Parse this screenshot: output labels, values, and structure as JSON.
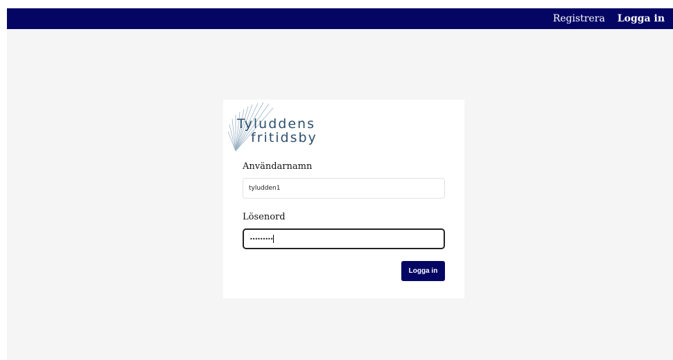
{
  "header": {
    "register_label": "Registrera",
    "login_label": "Logga in"
  },
  "logo": {
    "line1": "Tyluddens",
    "line2": "fritidsby"
  },
  "form": {
    "username_label": "Användarnamn",
    "username_value": "tyludden1",
    "password_label": "Lösenord",
    "password_masked": "•••••••••",
    "submit_label": "Logga in"
  },
  "colors": {
    "brand_navy": "#050564",
    "logo_text": "#2c4f6e",
    "background": "#f5f5f5"
  }
}
